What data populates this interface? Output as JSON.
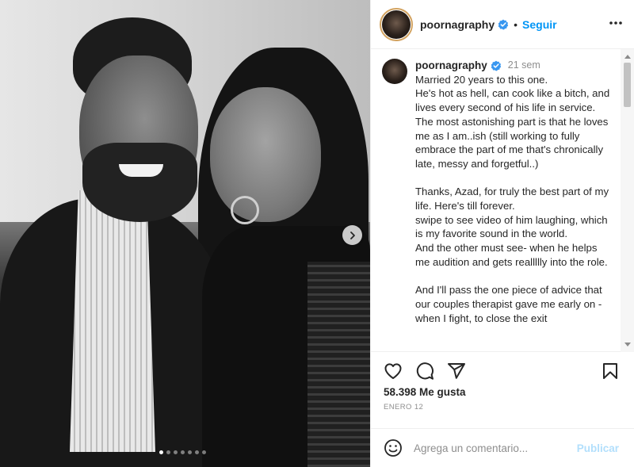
{
  "post": {
    "image_alt": "",
    "carousel": {
      "slide_count": 7,
      "current_slide": 1
    },
    "icons": {
      "next": "chevron-right-icon"
    }
  },
  "header": {
    "username": "poornagraphy",
    "separator": "•",
    "follow_label": "Seguir",
    "icons": {
      "verified": "verified-badge-icon",
      "more": "more-options-icon"
    }
  },
  "caption": {
    "username": "poornagraphy",
    "time": "21 sem",
    "paragraphs": [
      "Married 20 years to this one.",
      "He's hot as hell, can cook like a bitch, and lives every second of his life in service.",
      "The most astonishing part is that he loves me as I am..ish  (still working to fully embrace the part of me that's chronically late, messy and forgetful..)",
      "",
      "Thanks, Azad, for truly the best part of my life. Here's till forever.",
      "swipe to see video of him laughing, which is my favorite sound in the world.",
      "And  the other must see- when he helps me audition and gets reallllly into the role.",
      "",
      "And I'll pass the one piece of advice that our couples therapist gave me early on - when I fight, to close the exit"
    ]
  },
  "actions": {
    "icons": [
      "heart-icon",
      "comment-icon",
      "share-icon",
      "bookmark-icon"
    ]
  },
  "likes": "58.398 Me gusta",
  "date": "ENERO 12",
  "comment": {
    "placeholder": "Agrega un comentario...",
    "value": "",
    "publish_label": "Publicar",
    "icons": {
      "emoji": "emoji-icon"
    }
  },
  "colors": {
    "accent": "#0095f6",
    "publish_disabled": "#b2dffc",
    "text": "#262626",
    "muted": "#8e8e8e",
    "border": "#efefef"
  }
}
